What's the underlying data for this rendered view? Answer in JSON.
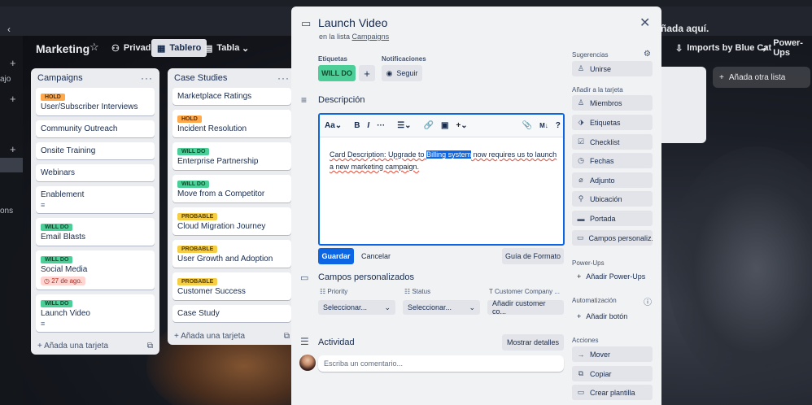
{
  "announce": {
    "text": "ñada aquí."
  },
  "rail": {
    "texts": [
      "ajo",
      "ons"
    ]
  },
  "board": {
    "title": "Marketing",
    "views": {
      "private": "Privado",
      "board": "Tablero",
      "table": "Tabla"
    },
    "right": {
      "imports": "Imports by Blue Cat",
      "powerups": "Power-Ups"
    }
  },
  "lists": [
    {
      "title": "Campaigns",
      "cards": [
        {
          "label": "HOLD",
          "label_type": "hold",
          "title": "User/Subscriber Interviews"
        },
        {
          "title": "Community Outreach"
        },
        {
          "title": "Onsite Training"
        },
        {
          "title": "Webinars"
        },
        {
          "title": "Enablement",
          "desc": true
        },
        {
          "label": "WILL DO",
          "label_type": "willdo",
          "title": "Email Blasts"
        },
        {
          "label": "WILL DO",
          "label_type": "willdo",
          "title": "Social Media",
          "due": "27 de ago."
        },
        {
          "label": "WILL DO",
          "label_type": "willdo",
          "title": "Launch Video",
          "desc": true
        }
      ],
      "add_card": "Añada una tarjeta"
    },
    {
      "title": "Case Studies",
      "cards": [
        {
          "title": "Marketplace Ratings"
        },
        {
          "label": "HOLD",
          "label_type": "hold",
          "title": "Incident Resolution"
        },
        {
          "label": "WILL DO",
          "label_type": "willdo",
          "title": "Enterprise Partnership"
        },
        {
          "label": "WILL DO",
          "label_type": "willdo",
          "title": "Move from a Competitor"
        },
        {
          "label": "PROBABLE",
          "label_type": "probable",
          "title": "Cloud Migration Journey"
        },
        {
          "label": "PROBABLE",
          "label_type": "probable",
          "title": "User Growth and Adoption"
        },
        {
          "label": "PROBABLE",
          "label_type": "probable",
          "title": "Customer Success"
        },
        {
          "title": "Case Study"
        }
      ],
      "add_card": "Añada una tarjeta"
    }
  ],
  "add_list": "Añada otra lista",
  "modal": {
    "title": "Launch Video",
    "in_list_prefix": "en la lista",
    "in_list_name": "Campaigns",
    "labels_heading": "Etiquetas",
    "label_value": "WILL DO",
    "notifications_heading": "Notificaciones",
    "follow": "Seguir",
    "description_title": "Descripción",
    "toolbar": {
      "text_style": "Aa"
    },
    "description": {
      "part1": "Card Description: Upgrade to ",
      "highlight": "Billing system",
      "part2": " now requires us to launch a new marketing campaign."
    },
    "save": "Guardar",
    "cancel": "Cancelar",
    "format_guide": "Guía de Formato",
    "custom_fields_title": "Campos personalizados",
    "fields": [
      {
        "label": "Priority",
        "value": "Seleccionar..."
      },
      {
        "label": "Status",
        "value": "Seleccionar..."
      },
      {
        "label": "Customer Company ...",
        "value": "Añadir customer co..."
      }
    ],
    "activity_title": "Actividad",
    "show_details": "Mostrar detalles",
    "comment_placeholder": "Escriba un comentario..."
  },
  "sidebar": {
    "suggestions": "Sugerencias",
    "join": "Unirse",
    "add_to_card": "Añadir a la tarjeta",
    "items": [
      "Miembros",
      "Etiquetas",
      "Checklist",
      "Fechas",
      "Adjunto",
      "Ubicación",
      "Portada",
      "Campos personaliz..."
    ],
    "powerups_heading": "Power-Ups",
    "add_powerups": "Añadir Power-Ups",
    "automation_heading": "Automatización",
    "add_button": "Añadir botón",
    "actions_heading": "Acciones",
    "actions": [
      "Mover",
      "Copiar",
      "Crear plantilla"
    ]
  },
  "colors": {
    "accent": "#0c66e4",
    "willdo": "#4bce97",
    "hold": "#ffa94d",
    "probable": "#f5cd47"
  }
}
